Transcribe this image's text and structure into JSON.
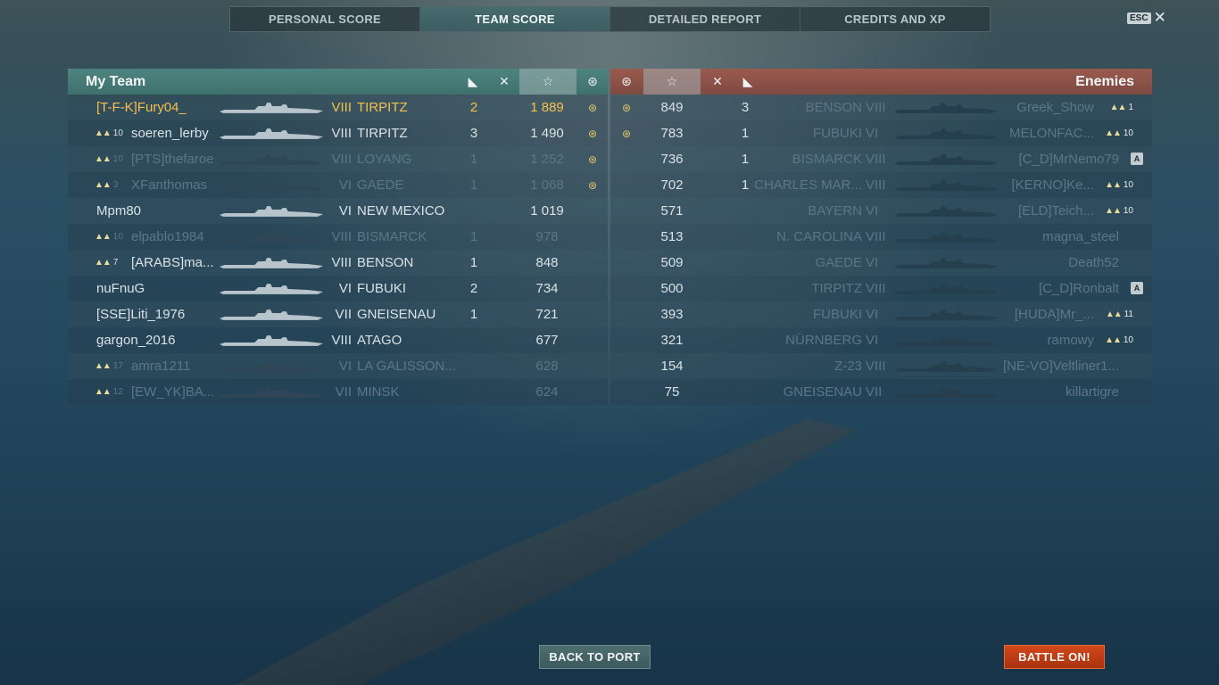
{
  "tabs": [
    {
      "label": "PERSONAL SCORE",
      "active": false
    },
    {
      "label": "TEAM SCORE",
      "active": true
    },
    {
      "label": "DETAILED REPORT",
      "active": false
    },
    {
      "label": "CREDITS AND XP",
      "active": false
    }
  ],
  "esc": {
    "key": "ESC",
    "close": "✕"
  },
  "my_team": {
    "title": "My Team",
    "rows": [
      {
        "rank": "",
        "name": "[T-F-K]Fury04_",
        "tier": "VIII",
        "ship": "TIRPITZ",
        "kills": "2",
        "score": "1 889",
        "base": true,
        "me": true,
        "dead": false
      },
      {
        "rank": "10",
        "name": "soeren_lerby",
        "tier": "VIII",
        "ship": "TIRPITZ",
        "kills": "3",
        "score": "1 490",
        "base": true,
        "me": false,
        "dead": false
      },
      {
        "rank": "10",
        "name": "[PTS]thefaroe",
        "tier": "VIII",
        "ship": "LOYANG",
        "kills": "1",
        "score": "1 252",
        "base": true,
        "me": false,
        "dead": true
      },
      {
        "rank": "3",
        "name": "XFanthomas",
        "tier": "VI",
        "ship": "GAEDE",
        "kills": "1",
        "score": "1 068",
        "base": true,
        "me": false,
        "dead": true
      },
      {
        "rank": "",
        "name": "Mpm80",
        "tier": "VI",
        "ship": "NEW MEXICO",
        "kills": "",
        "score": "1 019",
        "base": false,
        "me": false,
        "dead": false
      },
      {
        "rank": "10",
        "name": "elpablo1984",
        "tier": "VIII",
        "ship": "BISMARCK",
        "kills": "1",
        "score": "978",
        "base": false,
        "me": false,
        "dead": true
      },
      {
        "rank": "7",
        "name": "[ARABS]ma...",
        "tier": "VIII",
        "ship": "BENSON",
        "kills": "1",
        "score": "848",
        "base": false,
        "me": false,
        "dead": false
      },
      {
        "rank": "",
        "name": "nuFnuG",
        "tier": "VI",
        "ship": "FUBUKI",
        "kills": "2",
        "score": "734",
        "base": false,
        "me": false,
        "dead": false
      },
      {
        "rank": "",
        "name": "[SSE]Liti_1976",
        "tier": "VII",
        "ship": "GNEISENAU",
        "kills": "1",
        "score": "721",
        "base": false,
        "me": false,
        "dead": false
      },
      {
        "rank": "",
        "name": "gargon_2016",
        "tier": "VIII",
        "ship": "ATAGO",
        "kills": "",
        "score": "677",
        "base": false,
        "me": false,
        "dead": false
      },
      {
        "rank": "17",
        "name": "amra1211",
        "tier": "VI",
        "ship": "LA GALISSON...",
        "kills": "",
        "score": "628",
        "base": false,
        "me": false,
        "dead": true
      },
      {
        "rank": "12",
        "name": "[EW_YK]BA...",
        "tier": "VII",
        "ship": "MINSK",
        "kills": "",
        "score": "624",
        "base": false,
        "me": false,
        "dead": true
      }
    ]
  },
  "enemies": {
    "title": "Enemies",
    "rows": [
      {
        "base": true,
        "score": "849",
        "kills": "3",
        "ship": "BENSON",
        "tier": "VIII",
        "name": "Greek_Show",
        "rank": "1",
        "flag": false,
        "dead": true
      },
      {
        "base": true,
        "score": "783",
        "kills": "1",
        "ship": "FUBUKI",
        "tier": "VI",
        "name": "MELONFAC...",
        "rank": "10",
        "flag": false,
        "dead": true
      },
      {
        "base": false,
        "score": "736",
        "kills": "1",
        "ship": "BISMARCK",
        "tier": "VIII",
        "name": "[C_D]MrNemo79",
        "rank": "",
        "flag": true,
        "dead": true
      },
      {
        "base": false,
        "score": "702",
        "kills": "1",
        "ship": "CHARLES MAR...",
        "tier": "VIII",
        "name": "[KERNO]Ke...",
        "rank": "10",
        "flag": false,
        "dead": true
      },
      {
        "base": false,
        "score": "571",
        "kills": "",
        "ship": "BAYERN",
        "tier": "VI",
        "name": "[ELD]Teich...",
        "rank": "10",
        "flag": false,
        "dead": true
      },
      {
        "base": false,
        "score": "513",
        "kills": "",
        "ship": "N. CAROLINA",
        "tier": "VIII",
        "name": "magna_steel",
        "rank": "",
        "flag": false,
        "dead": true
      },
      {
        "base": false,
        "score": "509",
        "kills": "",
        "ship": "GAEDE",
        "tier": "VI",
        "name": "Death52",
        "rank": "",
        "flag": false,
        "dead": true
      },
      {
        "base": false,
        "score": "500",
        "kills": "",
        "ship": "TIRPITZ",
        "tier": "VIII",
        "name": "[C_D]Ronbalt",
        "rank": "",
        "flag": true,
        "dead": true
      },
      {
        "base": false,
        "score": "393",
        "kills": "",
        "ship": "FUBUKI",
        "tier": "VI",
        "name": "[HUDA]Mr_...",
        "rank": "11",
        "flag": false,
        "dead": true
      },
      {
        "base": false,
        "score": "321",
        "kills": "",
        "ship": "NÜRNBERG",
        "tier": "VI",
        "name": "ramowy",
        "rank": "10",
        "flag": false,
        "dead": true
      },
      {
        "base": false,
        "score": "154",
        "kills": "",
        "ship": "Z-23",
        "tier": "VIII",
        "name": "[NE-VO]Veltliner1...",
        "rank": "",
        "flag": false,
        "dead": true
      },
      {
        "base": false,
        "score": "75",
        "kills": "",
        "ship": "GNEISENAU",
        "tier": "VII",
        "name": "killartigre",
        "rank": "",
        "flag": false,
        "dead": true
      }
    ]
  },
  "flag_letter": "A",
  "buttons": {
    "back": "BACK TO PORT",
    "battle": "BATTLE ON!"
  }
}
